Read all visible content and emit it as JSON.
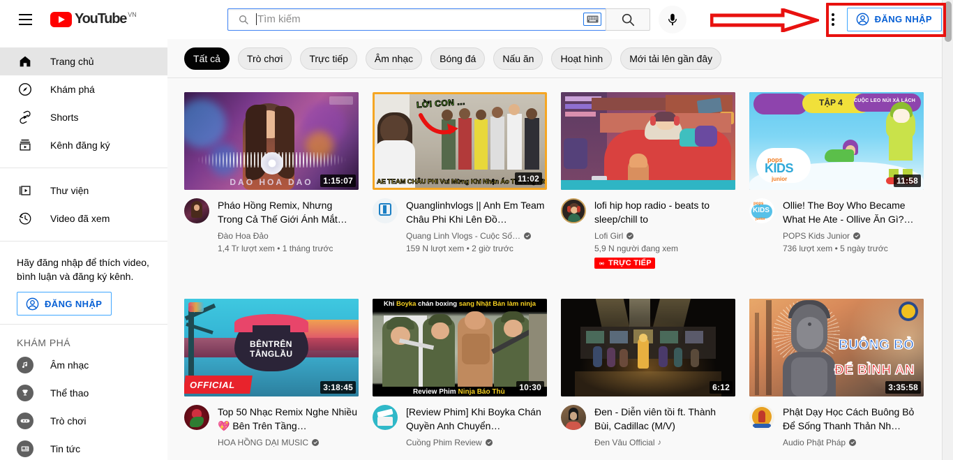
{
  "topbar": {
    "menu_icon": "hamburger-menu-icon",
    "logo_text": "YouTube",
    "logo_country": "VN",
    "search": {
      "placeholder": "Tìm kiếm",
      "value": "",
      "search_icon": "search-icon",
      "keyboard_icon": "keyboard-icon",
      "submit_icon": "search-icon"
    },
    "mic_icon": "microphone-icon",
    "kebab_icon": "more-vertical-icon",
    "signin_label": "ĐĂNG NHẬP",
    "signin_icon": "account-circle-icon"
  },
  "sidebar": {
    "primary": [
      {
        "label": "Trang chủ",
        "icon": "home-icon",
        "active": true
      },
      {
        "label": "Khám phá",
        "icon": "compass-icon",
        "active": false
      },
      {
        "label": "Shorts",
        "icon": "shorts-icon",
        "active": false
      },
      {
        "label": "Kênh đăng ký",
        "icon": "subscriptions-icon",
        "active": false
      }
    ],
    "secondary": [
      {
        "label": "Thư viện",
        "icon": "library-icon"
      },
      {
        "label": "Video đã xem",
        "icon": "history-icon"
      }
    ],
    "promo_text": "Hãy đăng nhập để thích video, bình luận và đăng ký kênh.",
    "promo_button": "ĐĂNG NHẬP",
    "promo_button_icon": "account-circle-icon",
    "explore_heading": "KHÁM PHÁ",
    "explore": [
      {
        "label": "Âm nhạc",
        "icon": "music-note-icon"
      },
      {
        "label": "Thể thao",
        "icon": "trophy-icon"
      },
      {
        "label": "Trò chơi",
        "icon": "gaming-icon"
      },
      {
        "label": "Tin tức",
        "icon": "news-icon"
      }
    ]
  },
  "chips": [
    {
      "label": "Tất cả",
      "selected": true
    },
    {
      "label": "Trò chơi",
      "selected": false
    },
    {
      "label": "Trực tiếp",
      "selected": false
    },
    {
      "label": "Âm nhạc",
      "selected": false
    },
    {
      "label": "Bóng đá",
      "selected": false
    },
    {
      "label": "Nấu ăn",
      "selected": false
    },
    {
      "label": "Hoạt hình",
      "selected": false
    },
    {
      "label": "Mới tải lên gần đây",
      "selected": false
    }
  ],
  "videos": [
    {
      "title": "Pháo Hồng Remix, Nhưng Trong Cả Thế Giới Ánh Mắt…",
      "channel": "Đào Hoa Đảo",
      "verified": false,
      "music_badge": false,
      "stats": "1,4 Tr lượt xem • 1 tháng trước",
      "duration": "1:15:07",
      "live": false,
      "live_label": "",
      "thumb_overlay_text": "DAO HOA DAO"
    },
    {
      "title": "Quanglinhvlogs || Anh Em Team Châu Phi Khi Lên Đồ…",
      "channel": "Quang Linh Vlogs - Cuộc Số…",
      "verified": true,
      "music_badge": false,
      "stats": "159 N lượt xem • 2 giờ trước",
      "duration": "11:02",
      "live": false,
      "live_label": "",
      "thumb_overlay_text": "AE TEAM CHÂU PHI Vui Mừng Khi Nhận Áo Thương Hiệu"
    },
    {
      "title": "lofi hip hop radio - beats to sleep/chill to",
      "channel": "Lofi Girl",
      "verified": true,
      "music_badge": false,
      "stats": "5,9 N người đang xem",
      "duration": "",
      "live": true,
      "live_label": "TRỰC TIẾP",
      "thumb_overlay_text": ""
    },
    {
      "title": "Ollie! The Boy Who Became What He Ate - Ollive Ăn Gì?…",
      "channel": "POPS Kids Junior",
      "verified": true,
      "music_badge": false,
      "stats": "736 lượt xem • 5 ngày trước",
      "duration": "11:58",
      "live": false,
      "live_label": "",
      "thumb_overlay_text": "TẬP 4"
    },
    {
      "title": "Top 50 Nhạc Remix Nghe Nhiều 💖 Bên Trên Tầng…",
      "channel": "HOA HỒNG DẠI MUSIC",
      "verified": true,
      "music_badge": false,
      "stats": "",
      "duration": "3:18:45",
      "live": false,
      "live_label": "",
      "thumb_overlay_text": "BÊN TRÊN TẦNG LẦU"
    },
    {
      "title": "[Review Phim] Khi Boyka Chán Quyền Anh Chuyển…",
      "channel": "Cuồng Phim Review",
      "verified": true,
      "music_badge": false,
      "stats": "",
      "duration": "10:30",
      "live": false,
      "live_label": "",
      "thumb_overlay_text": "Review Phim Ninja Báo Thù"
    },
    {
      "title": "Đen - Diễn viên tồi ft. Thành Bùi, Cadillac (M/V)",
      "channel": "Đen Vâu Official",
      "verified": false,
      "music_badge": true,
      "stats": "",
      "duration": "6:12",
      "live": false,
      "live_label": "",
      "thumb_overlay_text": ""
    },
    {
      "title": "Phật Dạy Học Cách Buông Bỏ Để Sống Thanh Thản Nh…",
      "channel": "Audio Phật Pháp",
      "verified": true,
      "music_badge": false,
      "stats": "",
      "duration": "3:35:58",
      "live": false,
      "live_label": "",
      "thumb_overlay_text": "BUÔNG BỎ ĐỂ BÌNH AN"
    }
  ],
  "annotation": {
    "arrow": "red-arrow-pointing-right",
    "highlight": "red-rectangle-around-signin-button",
    "color": "#e8110f"
  },
  "colors": {
    "brand_red": "#ff0000",
    "link_blue": "#065fd4",
    "border_blue": "#3ea6ff",
    "bg_grey": "#f9f9f9",
    "text_primary": "#030303",
    "text_secondary": "#606060",
    "annotation_red": "#e8110f"
  }
}
